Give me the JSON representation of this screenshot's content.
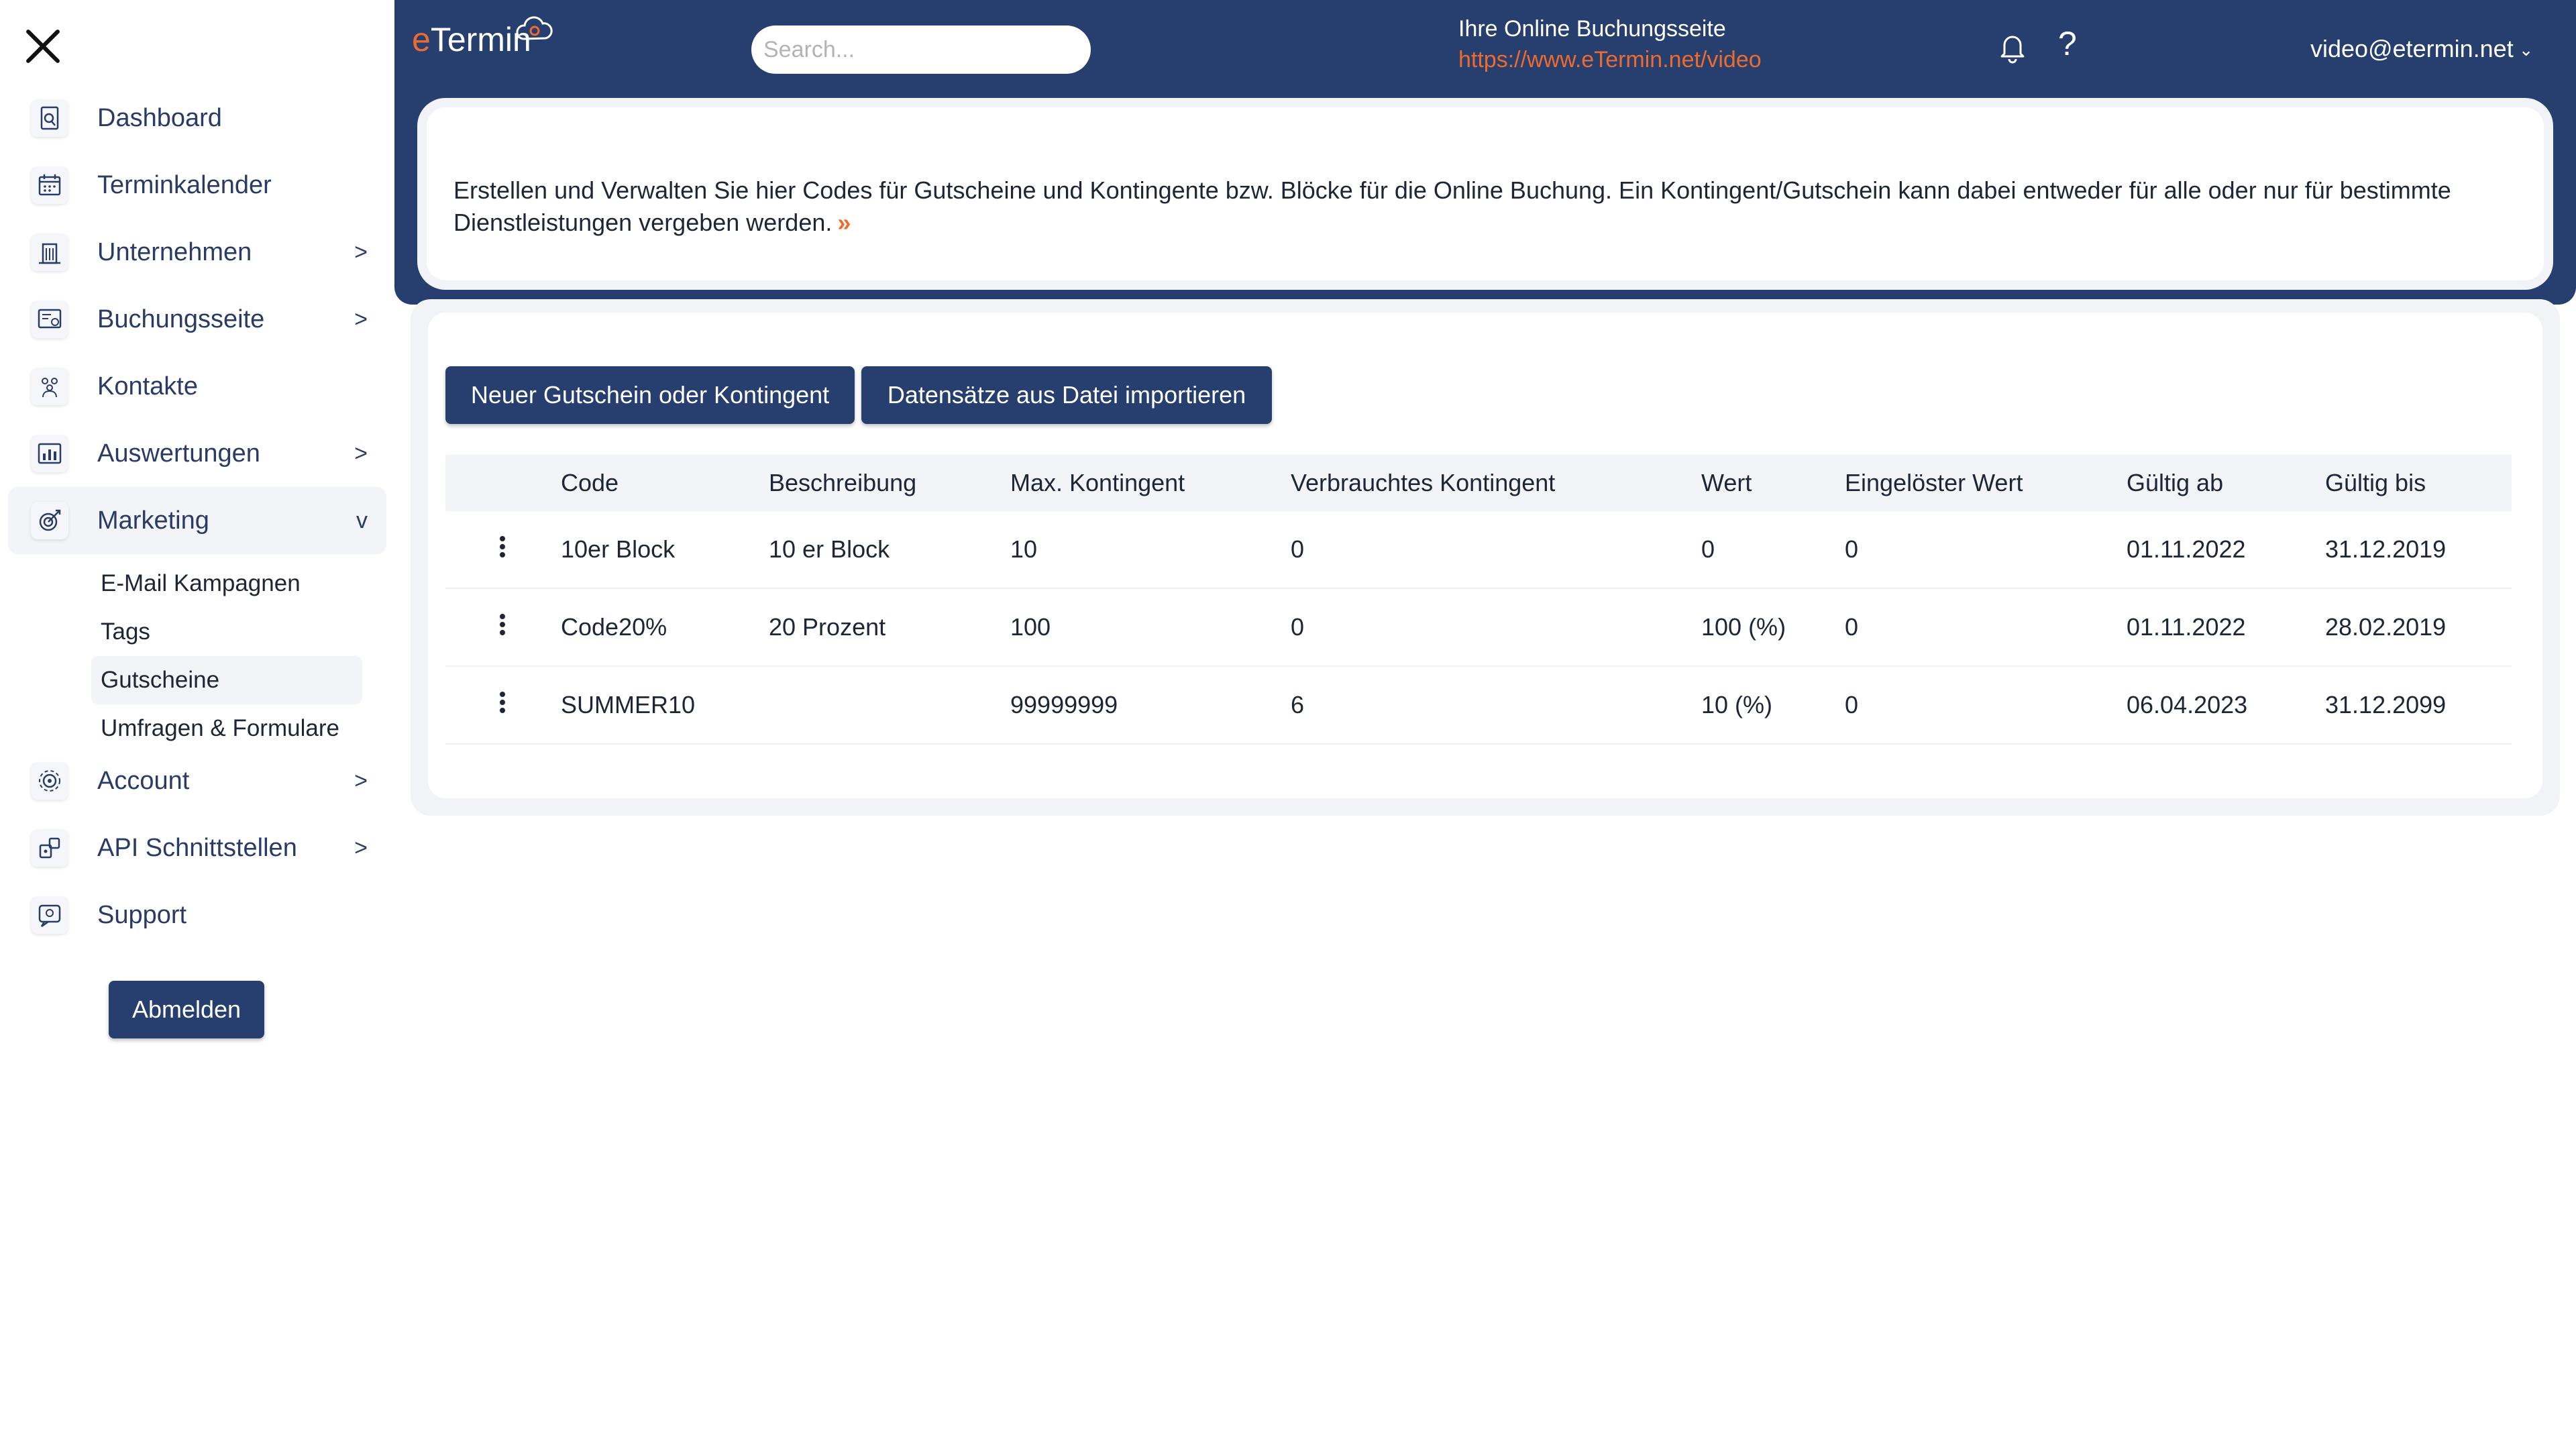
{
  "sidebar": {
    "items": [
      {
        "label": "Dashboard",
        "icon": "dashboard-icon",
        "arrow": ""
      },
      {
        "label": "Terminkalender",
        "icon": "calendar-icon",
        "arrow": ""
      },
      {
        "label": "Unternehmen",
        "icon": "building-icon",
        "arrow": ">"
      },
      {
        "label": "Buchungsseite",
        "icon": "booking-page-icon",
        "arrow": ">"
      },
      {
        "label": "Kontakte",
        "icon": "contacts-icon",
        "arrow": ""
      },
      {
        "label": "Auswertungen",
        "icon": "reports-icon",
        "arrow": ">"
      },
      {
        "label": "Marketing",
        "icon": "marketing-icon",
        "arrow": "v"
      },
      {
        "label": "Account",
        "icon": "account-icon",
        "arrow": ">"
      },
      {
        "label": "API Schnittstellen",
        "icon": "api-icon",
        "arrow": ">"
      },
      {
        "label": "Support",
        "icon": "support-icon",
        "arrow": ""
      }
    ],
    "subitems": [
      "E-Mail Kampagnen",
      "Tags",
      "Gutscheine",
      "Umfragen & Formulare"
    ],
    "logout_label": "Abmelden"
  },
  "header": {
    "logo_e": "e",
    "logo_rest": "Termin",
    "search_placeholder": "Search...",
    "booking_title": "Ihre Online Buchungsseite",
    "booking_url": "https://www.eTermin.net/video",
    "help_label": "?",
    "user_email": "video@etermin.net",
    "user_caret": "⌄"
  },
  "intro": {
    "text": "Erstellen und Verwalten Sie hier Codes für Gutscheine und Kontingente bzw. Blöcke für die Online Buchung. Ein Kontingent/Gutschein kann dabei entweder für alle oder nur für bestimmte Dienstleistungen vergeben werden.",
    "more_glyph": "»"
  },
  "toolbar": {
    "new_label": "Neuer Gutschein oder Kontingent",
    "import_label": "Datensätze aus Datei importieren"
  },
  "table": {
    "headers": [
      "Code",
      "Beschreibung",
      "Max. Kontingent",
      "Verbrauchtes Kontingent",
      "Wert",
      "Eingelöster Wert",
      "Gültig ab",
      "Gültig bis"
    ],
    "rows": [
      [
        "10er Block",
        "10 er Block",
        "10",
        "0",
        "0",
        "0",
        "01.11.2022",
        "31.12.2019"
      ],
      [
        "Code20%",
        "20 Prozent",
        "100",
        "0",
        "100 (%)",
        "0",
        "01.11.2022",
        "28.02.2019"
      ],
      [
        "SUMMER10",
        "",
        "99999999",
        "6",
        "10 (%)",
        "0",
        "06.04.2023",
        "31.12.2099"
      ]
    ]
  },
  "colors": {
    "primary": "#263f6e",
    "accent": "#ee6b2f",
    "background_panel": "#f1f3f7"
  }
}
